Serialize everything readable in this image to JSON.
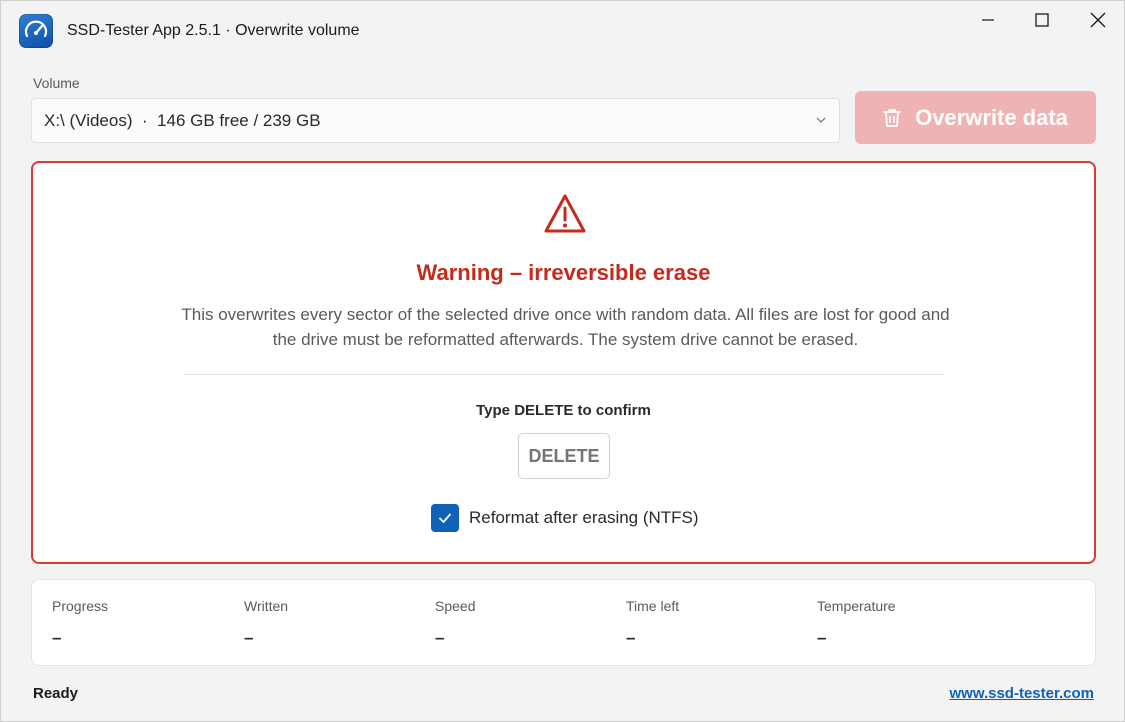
{
  "window": {
    "title": "SSD-Tester App 2.5.1 · Overwrite volume",
    "icon": "speedometer-icon"
  },
  "volume": {
    "label": "Volume",
    "selected": "X:\\ (Videos)  ·  146 GB free / 239 GB"
  },
  "toolbar": {
    "overwrite_label": "Overwrite data",
    "overwrite_enabled": false,
    "overwrite_color": "#f0b3b3"
  },
  "warning": {
    "title": "Warning – irreversible erase",
    "text": "This overwrites every sector of the selected drive once with random data. All files are lost for good and the drive must be reformatted afterwards. The system drive cannot be erased.",
    "confirm_label": "Type DELETE to confirm",
    "confirm_placeholder": "DELETE",
    "reformat_label": "Reformat after erasing (NTFS)",
    "reformat_checked": true,
    "accent_color": "#d93a3a"
  },
  "stats": {
    "progress_label": "Progress",
    "progress_value": "–",
    "written_label": "Written",
    "written_value": "–",
    "speed_label": "Speed",
    "speed_value": "–",
    "time_left_label": "Time left",
    "time_left_value": "–",
    "temperature_label": "Temperature",
    "temperature_value": "–"
  },
  "status": {
    "text": "Ready",
    "link": "www.ssd-tester.com"
  }
}
